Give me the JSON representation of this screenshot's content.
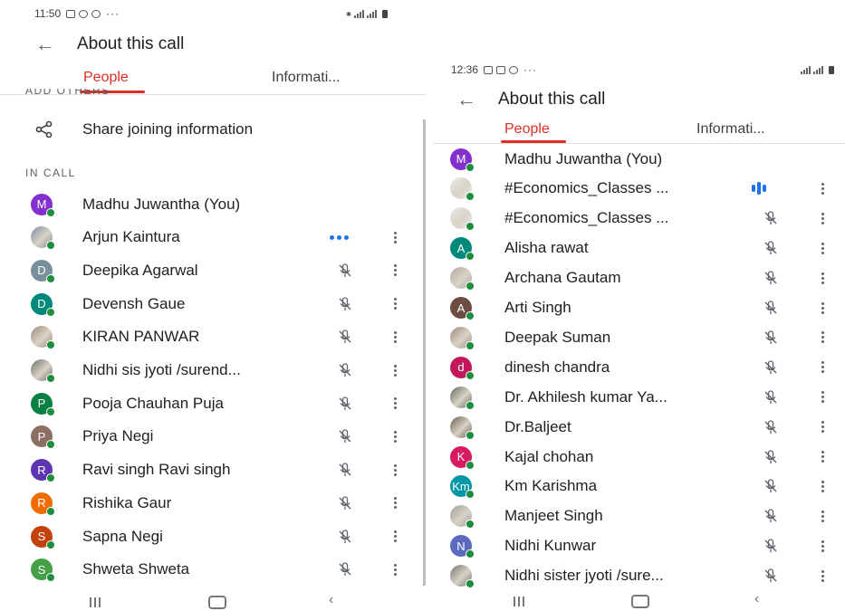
{
  "left": {
    "status": {
      "time": "11:50",
      "extra": "···"
    },
    "header": {
      "title": "About this call"
    },
    "tabs": {
      "people": "People",
      "information": "Informati..."
    },
    "add_others_label": "ADD OTHERS",
    "share_label": "Share joining information",
    "in_call_label": "IN CALL",
    "participants": [
      {
        "name": "Madhu Juwantha (You)",
        "initial": "M",
        "color": "#8430ce",
        "photo": false,
        "state": "none"
      },
      {
        "name": "Arjun Kaintura",
        "initial": "",
        "color": "#7a8fa6",
        "photo": true,
        "state": "speaking"
      },
      {
        "name": "Deepika Agarwal",
        "initial": "D",
        "color": "#78909c",
        "photo": false,
        "state": "muted"
      },
      {
        "name": "Devensh Gaue",
        "initial": "D",
        "color": "#00897b",
        "photo": false,
        "state": "muted"
      },
      {
        "name": "KIRAN PANWAR",
        "initial": "",
        "color": "#9e8a7a",
        "photo": true,
        "state": "muted"
      },
      {
        "name": "Nidhi sis jyoti /surend...",
        "initial": "",
        "color": "#6d6d6d",
        "photo": true,
        "state": "muted"
      },
      {
        "name": "Pooja Chauhan Puja",
        "initial": "P",
        "color": "#0b8043",
        "photo": false,
        "state": "muted"
      },
      {
        "name": "Priya Negi",
        "initial": "P",
        "color": "#8d6e63",
        "photo": false,
        "state": "muted"
      },
      {
        "name": "Ravi singh Ravi singh",
        "initial": "R",
        "color": "#5e35b1",
        "photo": false,
        "state": "muted"
      },
      {
        "name": "Rishika Gaur",
        "initial": "R",
        "color": "#ef6c00",
        "photo": false,
        "state": "muted"
      },
      {
        "name": "Sapna Negi",
        "initial": "S",
        "color": "#c2410c",
        "photo": false,
        "state": "muted"
      },
      {
        "name": "Shweta Shweta",
        "initial": "S",
        "color": "#43a047",
        "photo": false,
        "state": "muted"
      }
    ]
  },
  "right": {
    "status": {
      "time": "12:36",
      "extra": "···"
    },
    "header": {
      "title": "About this call"
    },
    "tabs": {
      "people": "People",
      "information": "Informati..."
    },
    "participants": [
      {
        "name": "Madhu Juwantha (You)",
        "initial": "M",
        "color": "#8430ce",
        "photo": false,
        "state": "none"
      },
      {
        "name": "#Economics_Classes ...",
        "initial": "",
        "color": "#e8eaed",
        "photo": true,
        "state": "talking"
      },
      {
        "name": "#Economics_Classes ...",
        "initial": "",
        "color": "#e8eaed",
        "photo": true,
        "state": "muted"
      },
      {
        "name": "Alisha rawat",
        "initial": "A",
        "color": "#00897b",
        "photo": false,
        "state": "muted"
      },
      {
        "name": "Archana Gautam",
        "initial": "",
        "color": "#b0a99f",
        "photo": true,
        "state": "muted"
      },
      {
        "name": "Arti Singh",
        "initial": "A",
        "color": "#6d4c41",
        "photo": false,
        "state": "muted"
      },
      {
        "name": "Deepak Suman",
        "initial": "",
        "color": "#a1887f",
        "photo": true,
        "state": "muted"
      },
      {
        "name": "dinesh chandra",
        "initial": "d",
        "color": "#c2185b",
        "photo": false,
        "state": "muted"
      },
      {
        "name": "Dr. Akhilesh kumar Ya...",
        "initial": "",
        "color": "#5d6b5d",
        "photo": true,
        "state": "muted"
      },
      {
        "name": "Dr.Baljeet",
        "initial": "",
        "color": "#6a5a4a",
        "photo": true,
        "state": "muted"
      },
      {
        "name": "Kajal chohan",
        "initial": "K",
        "color": "#d81b60",
        "photo": false,
        "state": "muted"
      },
      {
        "name": "Km Karishma",
        "initial": "Km",
        "color": "#0097a7",
        "photo": false,
        "state": "muted"
      },
      {
        "name": "Manjeet Singh",
        "initial": "",
        "color": "#9e9e9e",
        "photo": true,
        "state": "muted"
      },
      {
        "name": "Nidhi Kunwar",
        "initial": "N",
        "color": "#5c6bc0",
        "photo": false,
        "state": "muted"
      },
      {
        "name": "Nidhi sister jyoti /sure...",
        "initial": "",
        "color": "#757575",
        "photo": true,
        "state": "muted"
      }
    ]
  },
  "colors": {
    "accent": "#d93025",
    "online": "#1e8e3e",
    "speaking": "#1a73e8"
  }
}
